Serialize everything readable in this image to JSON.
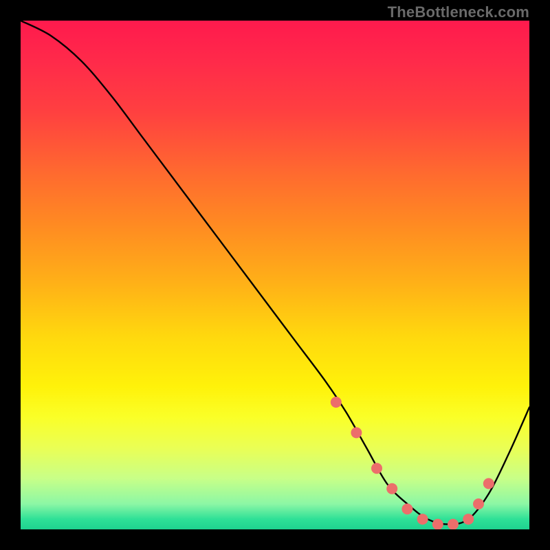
{
  "attribution": "TheBottleneck.com",
  "chart_data": {
    "type": "line",
    "title": "",
    "xlabel": "",
    "ylabel": "",
    "xlim": [
      0,
      100
    ],
    "ylim": [
      0,
      100
    ],
    "grid": false,
    "legend": false,
    "series": [
      {
        "name": "bottleneck-curve",
        "x": [
          0,
          6,
          12,
          18,
          24,
          30,
          36,
          42,
          48,
          54,
          60,
          64,
          68,
          72,
          76,
          80,
          84,
          88,
          92,
          96,
          100
        ],
        "y": [
          100,
          97,
          92,
          85,
          77,
          69,
          61,
          53,
          45,
          37,
          29,
          23,
          16,
          9,
          5,
          2,
          1,
          2,
          7,
          15,
          24
        ]
      }
    ],
    "markers": {
      "name": "highlight-points",
      "color": "#ec6e6b",
      "x": [
        62,
        66,
        70,
        73,
        76,
        79,
        82,
        85,
        88,
        90,
        92
      ],
      "y": [
        25,
        19,
        12,
        8,
        4,
        2,
        1,
        1,
        2,
        5,
        9
      ]
    },
    "background_gradient_stops": [
      {
        "pos": 0,
        "color": "#ff1a4d"
      },
      {
        "pos": 18,
        "color": "#ff4040"
      },
      {
        "pos": 40,
        "color": "#ff8a22"
      },
      {
        "pos": 62,
        "color": "#ffd80e"
      },
      {
        "pos": 78,
        "color": "#faff28"
      },
      {
        "pos": 90,
        "color": "#c8ff88"
      },
      {
        "pos": 100,
        "color": "#1fd28f"
      }
    ]
  }
}
